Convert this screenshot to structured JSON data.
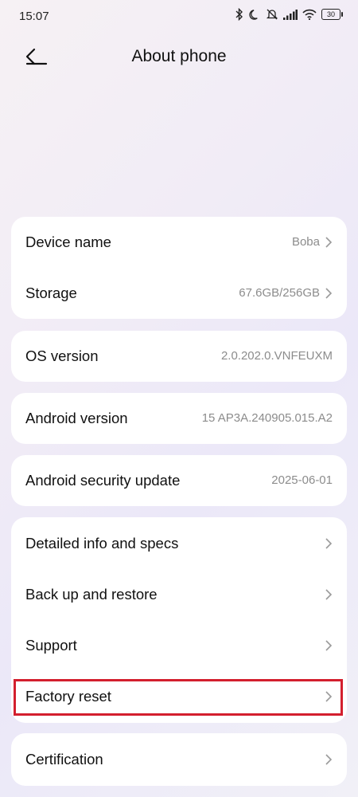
{
  "status_bar": {
    "time": "15:07",
    "battery": "30"
  },
  "header": {
    "title": "About phone"
  },
  "groups": {
    "device": [
      {
        "label": "Device name",
        "value": "Boba"
      },
      {
        "label": "Storage",
        "value": "67.6GB/256GB"
      }
    ],
    "os": {
      "label": "OS version",
      "value": "2.0.202.0.VNFEUXM"
    },
    "android": {
      "label": "Android version",
      "value": "15 AP3A.240905.015.A2"
    },
    "security": {
      "label": "Android security update",
      "value": "2025-06-01"
    },
    "more": [
      {
        "label": "Detailed info and specs"
      },
      {
        "label": "Back up and restore"
      },
      {
        "label": "Support"
      },
      {
        "label": "Factory reset"
      }
    ],
    "certification": {
      "label": "Certification"
    }
  },
  "colors": {
    "highlight": "#d31f2e",
    "value_text": "#8c8c8c"
  }
}
